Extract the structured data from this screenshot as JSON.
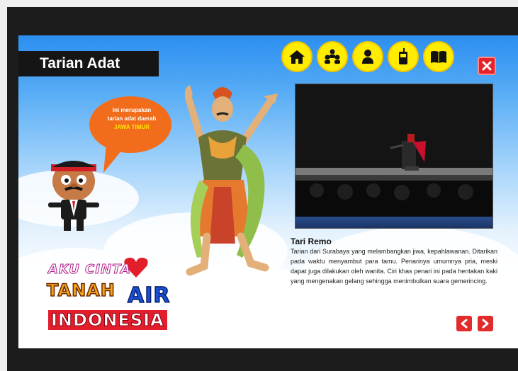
{
  "header": {
    "title": "Tarian Adat",
    "nav": [
      {
        "name": "home-icon"
      },
      {
        "name": "people-icon"
      },
      {
        "name": "person-icon"
      },
      {
        "name": "phone-icon"
      },
      {
        "name": "book-icon"
      }
    ],
    "close_icon": "close-icon"
  },
  "speech_bubble": {
    "line1": "Ini merupakan",
    "line2": "tarian adat daerah",
    "highlight": "JAWA TIMUR"
  },
  "video": {
    "title": "Tari Remo",
    "description": "Tarian dari Surabaya yang melambangkan jiwa, kepahlawanan. Ditarikan pada waktu menyambut para tamu. Penarinya umumnya pria, meski dapat juga dilakukan oleh wanita. Ciri khas penari ini pada hentakan kaki yang mengenakan gelang sehingga menimbulkan suara gemerincing."
  },
  "logo": {
    "line1": "AKU CINTA",
    "line2a": "TANAH",
    "line2b": "AIR",
    "line3": "INDONESIA"
  },
  "pager": {
    "prev_icon": "chevron-left-icon",
    "next_icon": "chevron-right-icon"
  },
  "colors": {
    "accent_yellow": "#ffec00",
    "danger_red": "#e4232a",
    "sky_blue": "#2c8ef0",
    "bubble_orange": "#f26d1b"
  }
}
